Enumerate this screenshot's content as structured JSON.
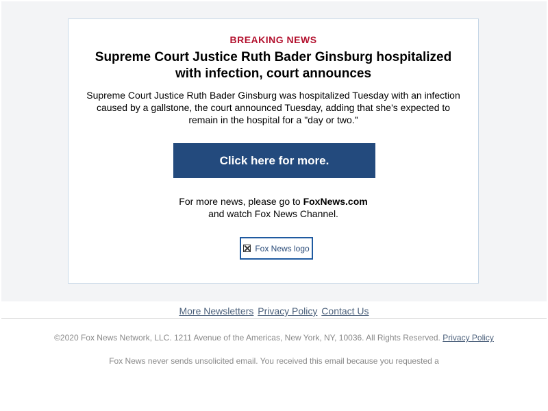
{
  "article": {
    "kicker": "BREAKING NEWS",
    "headline": "Supreme Court Justice Ruth Bader Ginsburg hospitalized with infection, court announces",
    "summary": "Supreme Court Justice Ruth Bader Ginsburg was hospitalized Tuesday with an infection caused by a gallstone, the court announced Tuesday, adding that she's expected to remain in the hospital for a \"day or two.\""
  },
  "cta": {
    "label": "Click here for more."
  },
  "more_news": {
    "prefix": "For more news, please go to ",
    "site": "FoxNews.com",
    "suffix": "and watch Fox News Channel."
  },
  "logo": {
    "alt": "Fox News logo",
    "icon": "broken-image-icon"
  },
  "footer": {
    "links": [
      "More Newsletters",
      "Privacy Policy",
      "Contact Us"
    ],
    "legal_text": "©2020 Fox News Network, LLC. 1211 Avenue of the Americas, New York, NY, 10036. All Rights Reserved.",
    "legal_link": "Privacy Policy",
    "notice": "Fox News never sends unsolicited email. You received this email because you requested a"
  },
  "colors": {
    "kicker": "#b3112e",
    "button": "#234a7d",
    "link": "#4a5f7a",
    "card_border": "#c5d6e6"
  }
}
